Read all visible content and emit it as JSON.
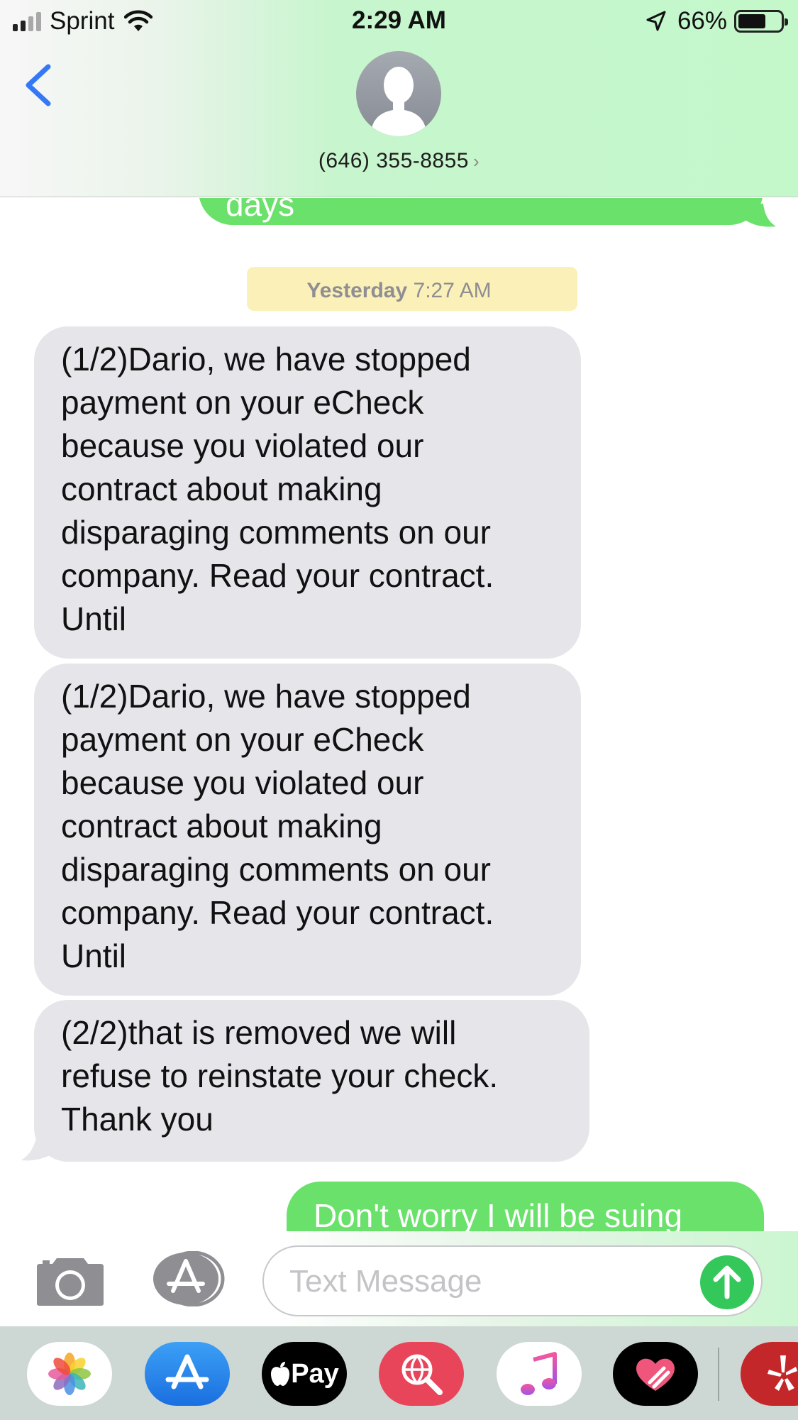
{
  "status_bar": {
    "carrier": "Sprint",
    "time": "2:29 AM",
    "battery_percent": "66%",
    "battery_level": 0.66
  },
  "header": {
    "back_icon": "chevron-left-icon",
    "avatar_icon": "person-silhouette-icon",
    "contact_number": "(646) 355-8855",
    "contact_chevron": "›"
  },
  "messages": {
    "partial_top_out": "days",
    "timestamp_day": "Yesterday",
    "timestamp_time": "7:27 AM",
    "items": [
      {
        "direction": "incoming",
        "text": "(1/2)Dario, we have stopped\npayment on your eCheck\nbecause you violated our\ncontract about making\ndisparaging comments on our\ncompany. Read your contract.\nUntil"
      },
      {
        "direction": "incoming",
        "text": "(1/2)Dario, we have stopped\npayment on your eCheck\nbecause you violated our\ncontract about making\ndisparaging comments on our\ncompany. Read your contract.\nUntil"
      },
      {
        "direction": "incoming",
        "text": "(2/2)that is removed we will\nrefuse to reinstate your check.\nThank you"
      },
      {
        "direction": "outgoing",
        "text": "Don't worry I will be suing"
      }
    ]
  },
  "input_bar": {
    "placeholder": "Text Message",
    "value": "",
    "camera_icon": "camera-icon",
    "apps_icon": "app-store-icon",
    "send_icon": "arrow-up-icon"
  },
  "app_drawer": {
    "apps": [
      {
        "name": "Photos",
        "icon": "photos-icon"
      },
      {
        "name": "App Store",
        "icon": "app-store-icon"
      },
      {
        "name": "Apple Pay",
        "icon": "apple-pay-icon",
        "label": "Pay"
      },
      {
        "name": "Search Images",
        "icon": "globe-search-icon"
      },
      {
        "name": "Music",
        "icon": "music-note-icon"
      },
      {
        "name": "Digital Touch",
        "icon": "heart-icon"
      },
      {
        "name": "Yelp",
        "icon": "yelp-icon"
      }
    ]
  },
  "colors": {
    "outgoing_bubble": "#6ae16b",
    "incoming_bubble": "#e5e5ea",
    "ios_blue": "#3478f6",
    "send_green": "#34c759"
  }
}
